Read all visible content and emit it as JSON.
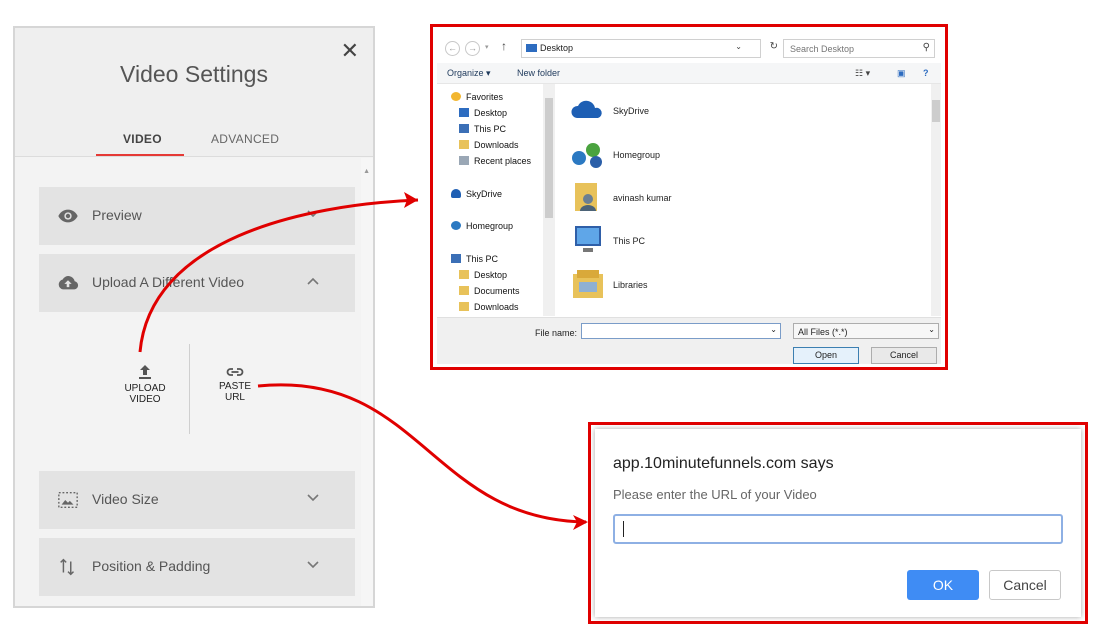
{
  "video_settings": {
    "title": "Video Settings",
    "close_glyph": "✕",
    "tabs": [
      {
        "label": "VIDEO",
        "active": true
      },
      {
        "label": "ADVANCED",
        "active": false
      }
    ],
    "sections": [
      {
        "label": "Preview",
        "icon": "eye-icon",
        "state": "collapsed"
      },
      {
        "label": "Upload A Different Video",
        "icon": "cloud-upload-icon",
        "state": "expanded"
      },
      {
        "label": "Video Size",
        "icon": "image-size-icon",
        "state": "collapsed"
      },
      {
        "label": "Position & Padding",
        "icon": "position-arrows-icon",
        "state": "collapsed"
      }
    ],
    "upload_options": {
      "upload_line1": "UPLOAD",
      "upload_line2": "VIDEO",
      "paste_line1": "PASTE",
      "paste_line2": "URL"
    }
  },
  "file_dialog": {
    "address": "Desktop",
    "search_placeholder": "Search Desktop",
    "toolbar": {
      "organize": "Organize ▾",
      "new_folder": "New folder"
    },
    "nav": [
      {
        "label": "Favorites",
        "icon": "star-icon",
        "level": 0
      },
      {
        "label": "Desktop",
        "icon": "desktop-icon",
        "level": 1
      },
      {
        "label": "This PC",
        "icon": "computer-icon",
        "level": 1
      },
      {
        "label": "Downloads",
        "icon": "downloads-icon",
        "level": 1
      },
      {
        "label": "Recent places",
        "icon": "recent-places-icon",
        "level": 1
      },
      {
        "label": "SkyDrive",
        "icon": "cloud-icon",
        "level": 0
      },
      {
        "label": "Homegroup",
        "icon": "homegroup-icon",
        "level": 0
      },
      {
        "label": "This PC",
        "icon": "computer-icon",
        "level": 0
      },
      {
        "label": "Desktop",
        "icon": "desktop-icon",
        "level": 1
      },
      {
        "label": "Documents",
        "icon": "documents-icon",
        "level": 1
      },
      {
        "label": "Downloads",
        "icon": "downloads-icon",
        "level": 1
      }
    ],
    "files": [
      {
        "label": "SkyDrive",
        "icon": "skydrive-icon"
      },
      {
        "label": "Homegroup",
        "icon": "homegroup-icon"
      },
      {
        "label": "avinash kumar",
        "icon": "user-folder-icon"
      },
      {
        "label": "This PC",
        "icon": "computer-icon"
      },
      {
        "label": "Libraries",
        "icon": "libraries-icon"
      }
    ],
    "file_name_label": "File name:",
    "file_name_value": "",
    "filter": "All Files (*.*)",
    "open_label": "Open",
    "cancel_label": "Cancel"
  },
  "prompt_dialog": {
    "title": "app.10minutefunnels.com says",
    "message": "Please enter the URL of your Video",
    "input_value": "",
    "ok_label": "OK",
    "cancel_label": "Cancel"
  },
  "colors": {
    "highlight_red": "#e00000",
    "tab_underline": "#e53935",
    "ok_blue": "#3f8cf4"
  }
}
